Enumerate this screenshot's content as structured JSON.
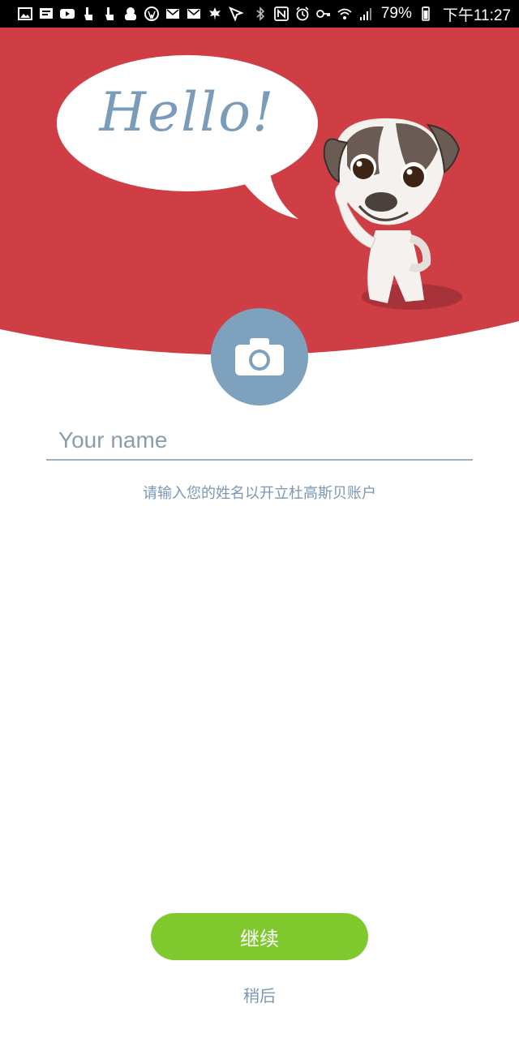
{
  "status_bar": {
    "battery": "79%",
    "time": "下午11:27",
    "left_icons": [
      "image-icon",
      "message-icon",
      "youtube-icon",
      "touch-icon",
      "touch-icon",
      "cloud-icon",
      "wordpress-icon",
      "mail-icon",
      "mail-icon",
      "maple-leaf-icon",
      "cursor-icon"
    ],
    "right_icons": [
      "bluetooth-icon",
      "nfc-icon",
      "alarm-icon",
      "key-icon",
      "wifi-icon",
      "signal-icon",
      "battery-icon"
    ]
  },
  "header": {
    "bubble_text": "Hello!",
    "background_color": "#cf3d45"
  },
  "camera": {
    "icon": "camera-icon",
    "color": "#7ea2bd"
  },
  "name_field": {
    "placeholder": "Your name",
    "value": ""
  },
  "hint_text": "请输入您的姓名以开立杜高斯贝账户",
  "continue_button": {
    "label": "继续",
    "color": "#7fc92f"
  },
  "later_link": {
    "label": "稍后"
  }
}
